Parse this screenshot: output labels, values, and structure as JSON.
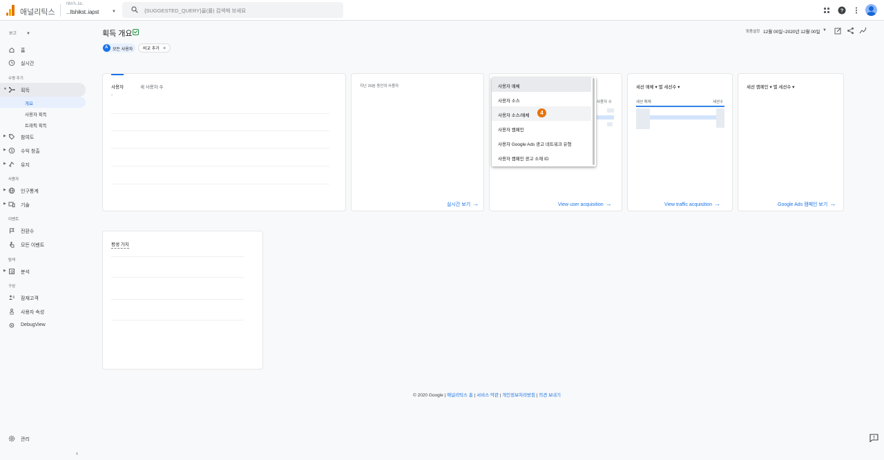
{
  "app": {
    "title": "애널리틱스",
    "account_line1": "NM-'h...li.ir...",
    "account_line2": "...ltshikst..iapst"
  },
  "search": {
    "placeholder": "{SUGGESTED_QUERY}을(를) 검색해 보세요"
  },
  "sidebar": {
    "report_label": "보고",
    "sections": {
      "lifecycle": "수명 주기",
      "user": "사용자",
      "events": "이벤트",
      "explore": "탐색",
      "configure": "구성"
    },
    "items": {
      "home": "홈",
      "realtime": "실시간",
      "acquisition": "획득",
      "acq_overview": "개요",
      "acq_user": "사용자 획득",
      "acq_traffic": "트래픽 획득",
      "engagement": "참여도",
      "monetization": "수익 창출",
      "retention": "유지",
      "demographics": "인구통계",
      "tech": "기술",
      "conversions": "전환수",
      "all_events": "모든 이벤트",
      "analysis": "분석",
      "audiences": "잠재고객",
      "user_props": "사용자 속성",
      "debugview": "DebugView",
      "admin": "관리"
    }
  },
  "page": {
    "title": "획득 개요",
    "chip_all_users": "모든 사용자",
    "chip_add_compare": "비교 추가",
    "date_label": "맞춤설정",
    "date_range": "12월 00일~2020년 12월 00일"
  },
  "cards": {
    "users_tab": "사용자",
    "new_users_tab": "새 사용자 수",
    "realtime_title": "지난 30분 동안의 사용자",
    "realtime_link": "실시간 보기",
    "user_acq_metric": "사용자 수",
    "user_acq_link": "View user acquisition",
    "session_medium_title": "세션 매체 ▾ 별 세션수 ▾",
    "session_medium_col": "세션 매체",
    "session_count_col": "세션수",
    "traffic_link": "View traffic acquisition",
    "session_campaign_title": "세션 캠페인 ▾ 별 세션수 ▾",
    "ads_link": "Google Ads 캠페인 보기",
    "ltv_title": "평생 가치"
  },
  "menu": {
    "items": [
      "사용자 매체",
      "사용자 소스",
      "사용자 소스/매체",
      "사용자 캠페인",
      "사용자 Google Ads 광고 네트워크 유형",
      "사용자 캠페인 광고 소재 ID"
    ],
    "badge": "4"
  },
  "footer": {
    "copyright": "© 2020 Google | ",
    "link_home": "애널리틱스 홈",
    "link_terms": "서비스 약관",
    "link_privacy": "개인정보처리방침",
    "link_feedback": "의견 보내기",
    "sep": " | "
  },
  "colors": {
    "accent": "#1a73e8",
    "badge": "#e8710a",
    "logo_orange": "#f9ab00",
    "logo_dark": "#e37400"
  }
}
